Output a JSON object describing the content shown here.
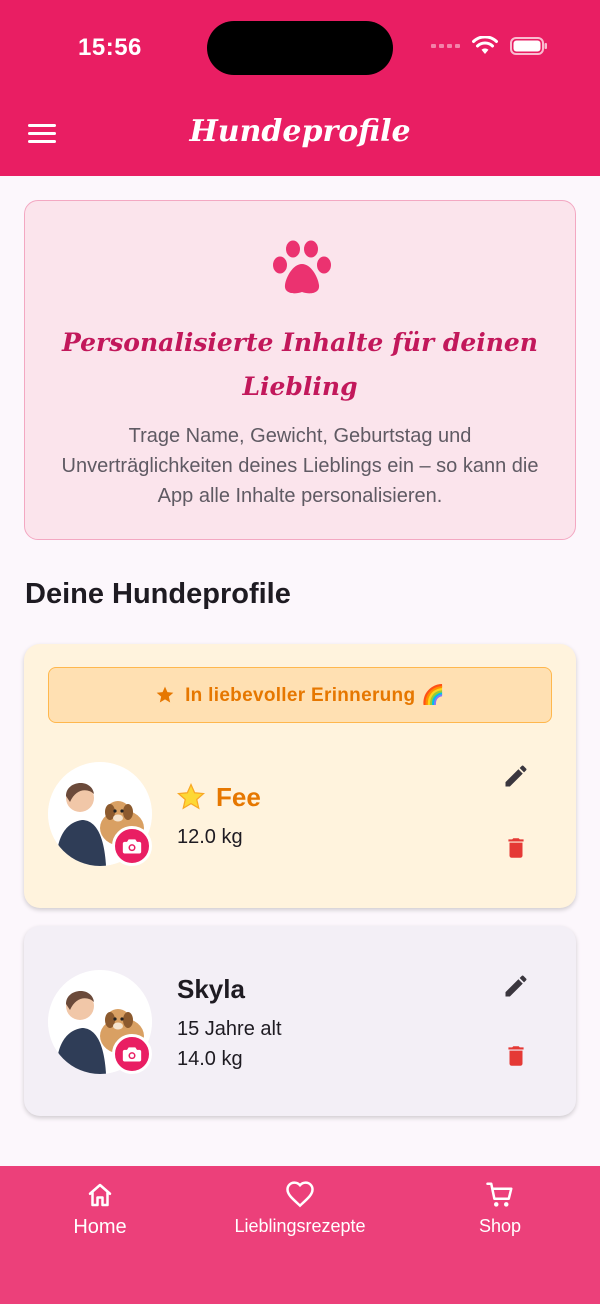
{
  "status": {
    "time": "15:56"
  },
  "app_bar": {
    "title": "Hundeprofile"
  },
  "info_card": {
    "title": "Personalisierte Inhalte für deinen Liebling",
    "text": "Trage Name, Gewicht, Geburtstag und Unverträglichkeiten deines Lieblings ein – so kann die App alle Inhalte personalisieren."
  },
  "section_title": "Deine Hundeprofile",
  "dogs": [
    {
      "name": "Fee",
      "memorial_label": "In liebevoller Erinnerung 🌈",
      "weight": "12.0 kg"
    },
    {
      "name": "Skyla",
      "age": "15 Jahre alt",
      "weight": "14.0 kg"
    }
  ],
  "bottom_nav": [
    {
      "label": "Home",
      "icon": "home-icon"
    },
    {
      "label": "Lieblingsrezepte",
      "icon": "heart-icon"
    },
    {
      "label": "Shop",
      "icon": "cart-icon"
    }
  ],
  "colors": {
    "primary": "#e91e63",
    "nav": "#ec407a",
    "memorial_accent": "#e67700",
    "delete": "#e53935"
  }
}
